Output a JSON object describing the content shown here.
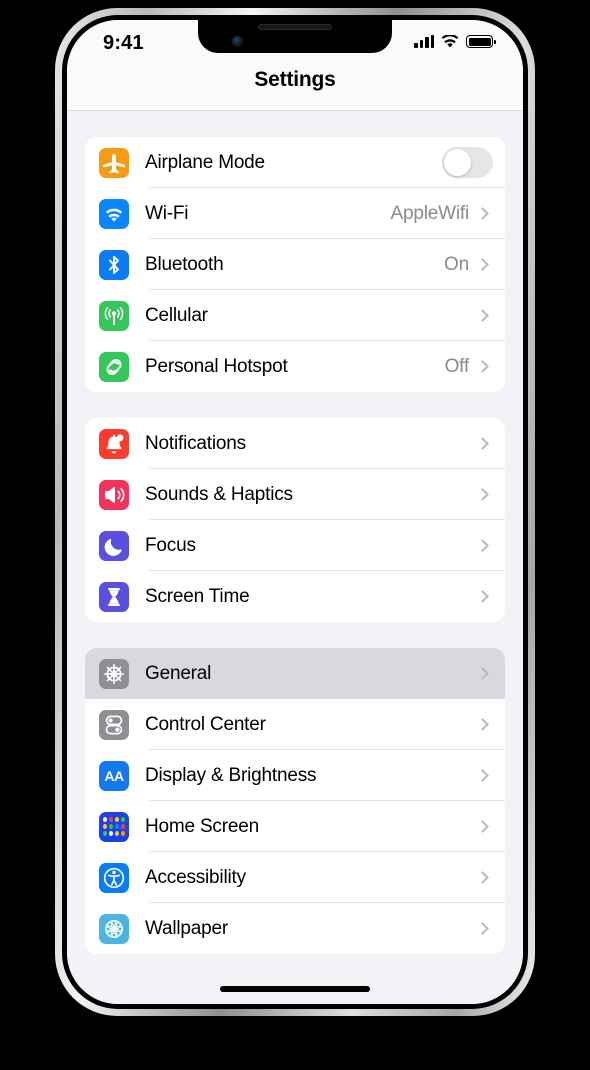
{
  "status_bar": {
    "time": "9:41",
    "cellular_icon": "cellular-signal-icon",
    "wifi_icon": "wifi-icon",
    "battery_icon": "battery-full-icon"
  },
  "nav_bar": {
    "title": "Settings"
  },
  "colors": {
    "screen_background": "#f2f2f7",
    "card_background": "#ffffff",
    "selected_row": "#d8d8dd",
    "value_text": "#8a8a8e",
    "chevron": "#b9b9be"
  },
  "groups": [
    {
      "rows": [
        {
          "label": "Airplane Mode",
          "icon": "airplane-icon",
          "icon_class": "ic-airplane",
          "accessory": "toggle",
          "toggle_on": false
        },
        {
          "label": "Wi-Fi",
          "icon": "wifi-icon",
          "icon_class": "ic-wifi",
          "accessory": "chevron",
          "value": "AppleWifi"
        },
        {
          "label": "Bluetooth",
          "icon": "bluetooth-icon",
          "icon_class": "ic-bluetooth",
          "accessory": "chevron",
          "value": "On"
        },
        {
          "label": "Cellular",
          "icon": "cellular-icon",
          "icon_class": "ic-cellular",
          "accessory": "chevron",
          "value": ""
        },
        {
          "label": "Personal Hotspot",
          "icon": "hotspot-icon",
          "icon_class": "ic-hotspot",
          "accessory": "chevron",
          "value": "Off"
        }
      ]
    },
    {
      "rows": [
        {
          "label": "Notifications",
          "icon": "bell-icon",
          "icon_class": "ic-notifications",
          "accessory": "chevron",
          "value": ""
        },
        {
          "label": "Sounds & Haptics",
          "icon": "speaker-icon",
          "icon_class": "ic-sounds",
          "accessory": "chevron",
          "value": ""
        },
        {
          "label": "Focus",
          "icon": "moon-icon",
          "icon_class": "ic-focus",
          "accessory": "chevron",
          "value": ""
        },
        {
          "label": "Screen Time",
          "icon": "hourglass-icon",
          "icon_class": "ic-screentime",
          "accessory": "chevron",
          "value": ""
        }
      ]
    },
    {
      "rows": [
        {
          "label": "General",
          "icon": "gear-icon",
          "icon_class": "ic-general",
          "accessory": "chevron",
          "value": "",
          "selected": true
        },
        {
          "label": "Control Center",
          "icon": "control-center-icon",
          "icon_class": "ic-controlcenter",
          "accessory": "chevron",
          "value": ""
        },
        {
          "label": "Display & Brightness",
          "icon": "display-brightness-icon",
          "icon_class": "ic-display",
          "accessory": "chevron",
          "value": ""
        },
        {
          "label": "Home Screen",
          "icon": "home-screen-icon",
          "icon_class": "ic-homescreen",
          "accessory": "chevron",
          "value": ""
        },
        {
          "label": "Accessibility",
          "icon": "accessibility-icon",
          "icon_class": "ic-accessibility",
          "accessory": "chevron",
          "value": ""
        },
        {
          "label": "Wallpaper",
          "icon": "wallpaper-icon",
          "icon_class": "ic-wallpaper",
          "accessory": "chevron",
          "value": ""
        }
      ]
    }
  ]
}
